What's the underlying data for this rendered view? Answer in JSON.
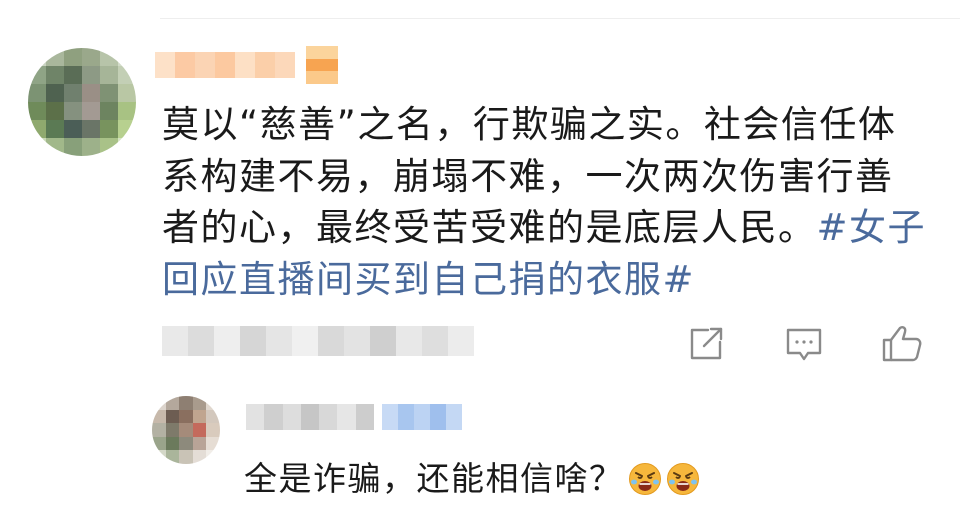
{
  "comment": {
    "text_line1": "莫以“慈善”之名，行欺骗之实。社会信任体",
    "text_line2": "系构建不易，崩塌不难，一次两次伤害行善",
    "text_line3": "者的心，最终受苦受难的是底层人民。",
    "hashtag_part1": "#女子",
    "hashtag_part2": "回应直播间买到自己捐的衣服#"
  },
  "actions": {
    "icons": [
      "share-icon",
      "comment-icon",
      "like-icon"
    ]
  },
  "reply": {
    "text": "全是诈骗，还能相信啥？",
    "emoji": [
      "angry-face-icon",
      "angry-face-icon"
    ]
  },
  "colors": {
    "hashtag": "#4a6a9c",
    "icon_gray": "#8a8a8a",
    "name_blur_orange": "#f7b27a",
    "badge_blur_blue": "#a8c6ef"
  }
}
